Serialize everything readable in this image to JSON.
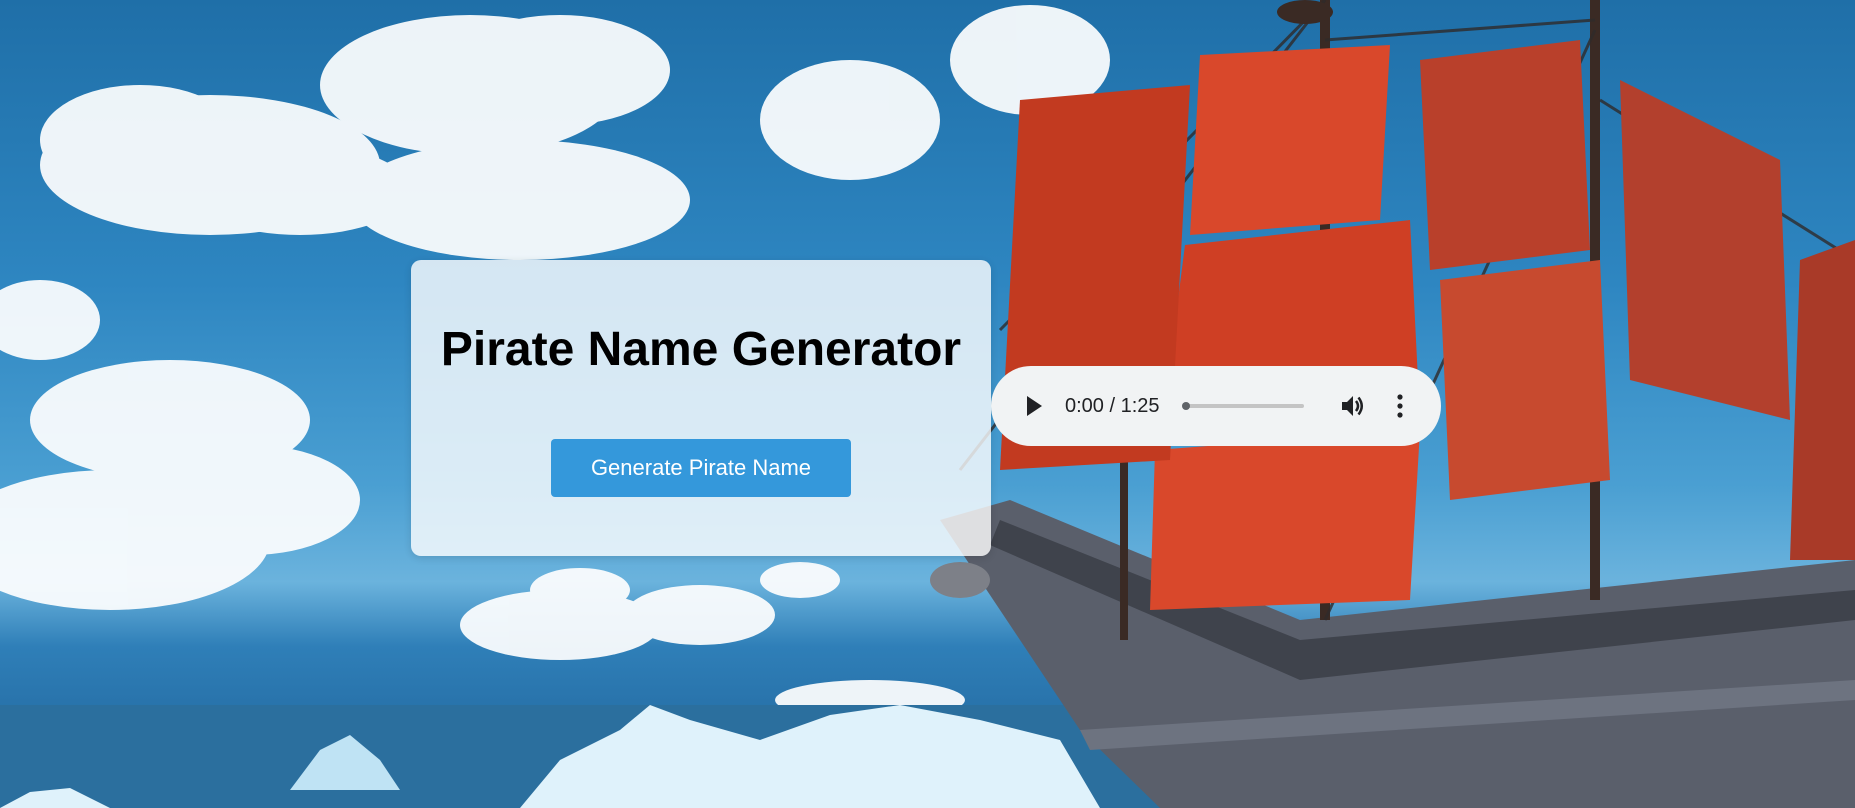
{
  "page": {
    "title": "Pirate Name Generator",
    "button_label": "Generate Pirate Name"
  },
  "audio_player": {
    "time_display": "0:00 / 1:25",
    "progress": 0,
    "icons": {
      "play": "play-icon",
      "volume": "volume-icon",
      "more": "more-options-icon"
    }
  },
  "colors": {
    "button_bg": "#3498db",
    "button_text": "#ffffff",
    "card_bg": "rgba(255,255,255,0.80)",
    "sky": "#2e86c1",
    "sail": "#d9482b"
  }
}
